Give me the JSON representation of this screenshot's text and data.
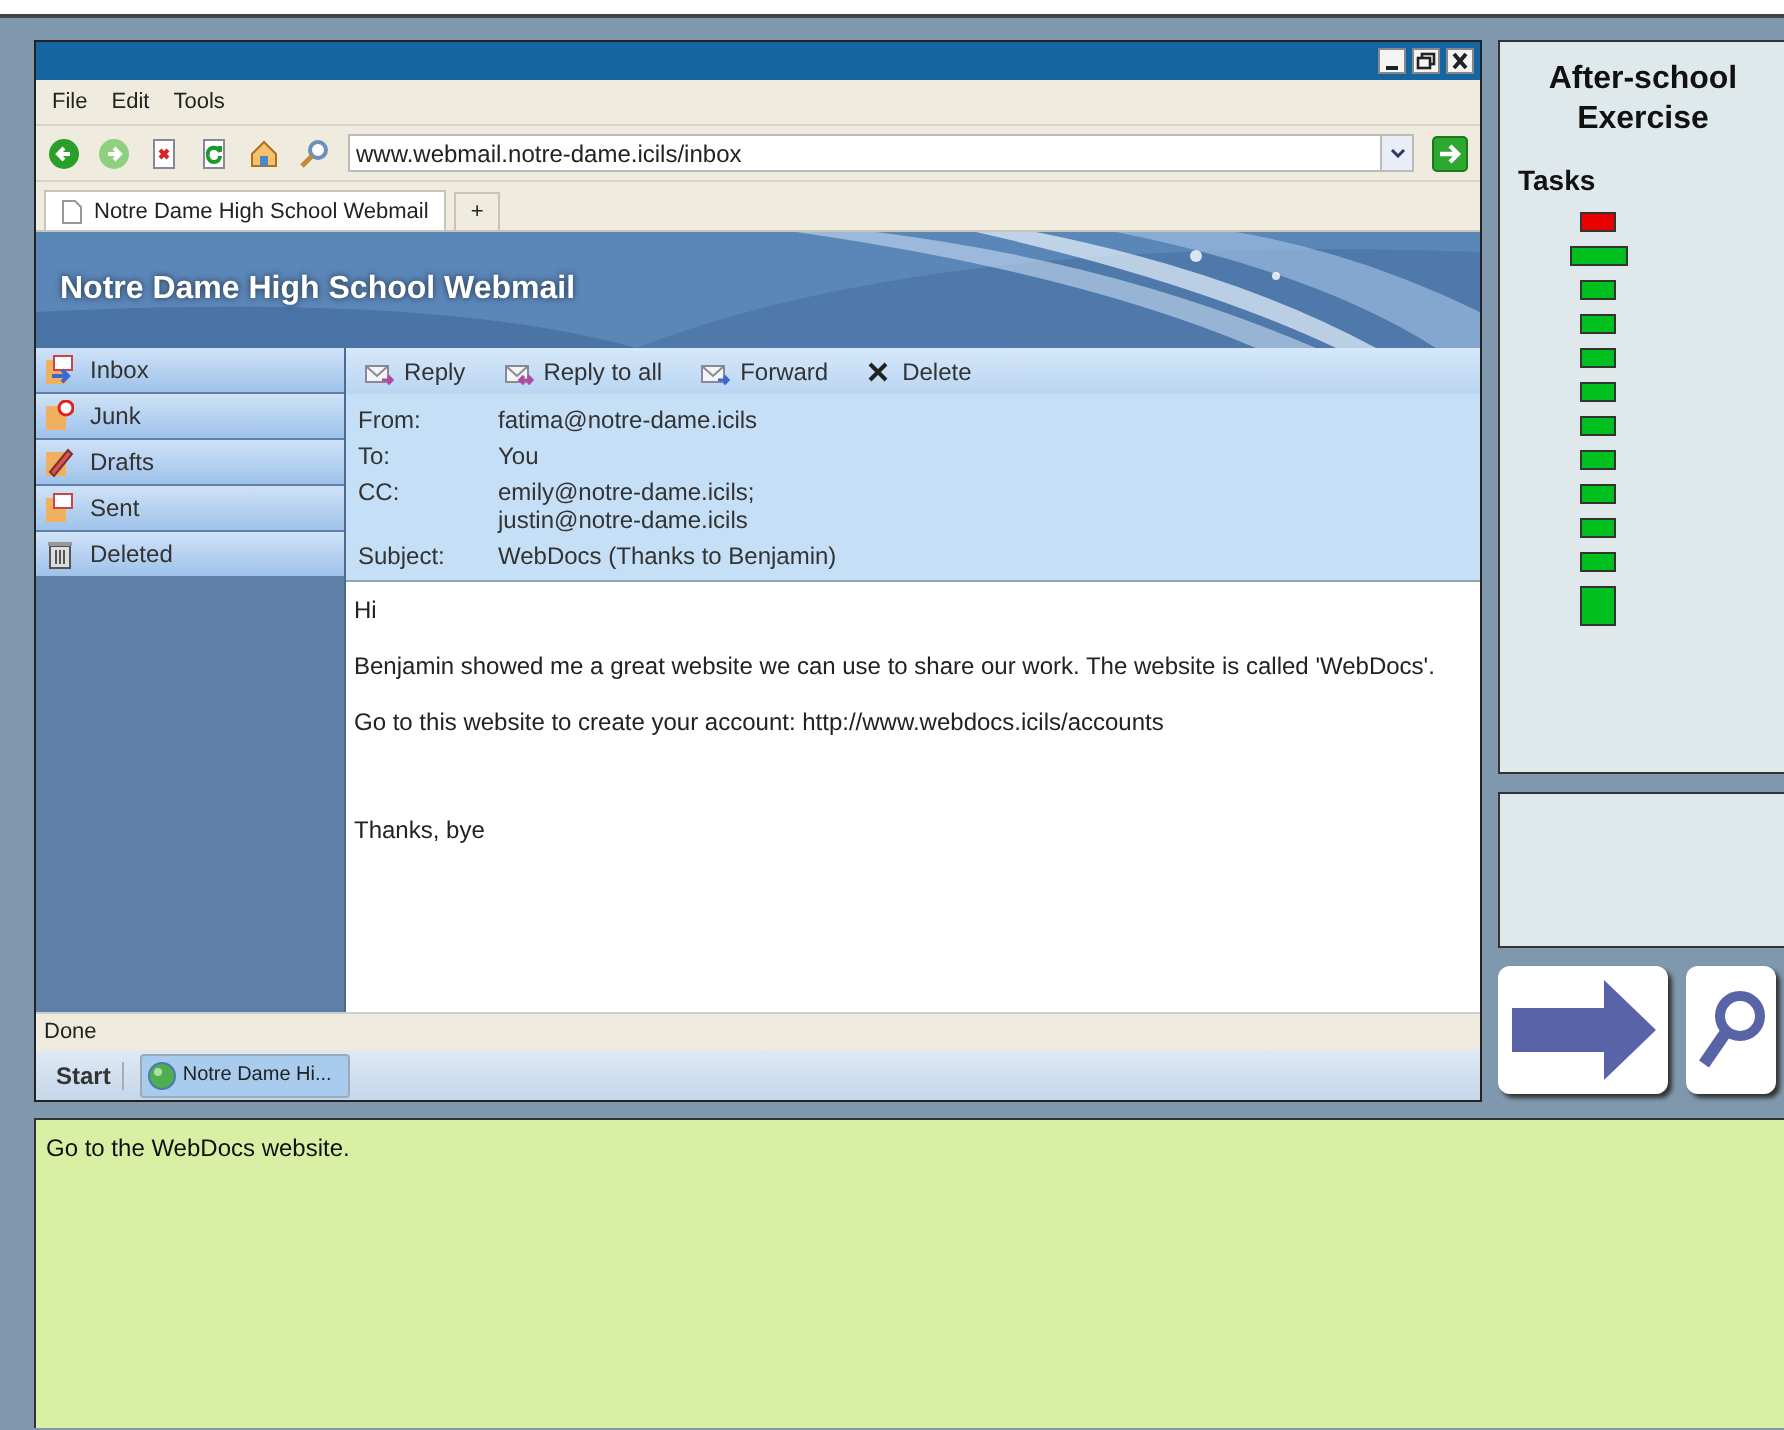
{
  "browser": {
    "menu": [
      "File",
      "Edit",
      "Tools"
    ],
    "address": "www.webmail.notre-dame.icils/inbox",
    "tabs": [
      {
        "label": "Notre Dame High School Webmail",
        "selected": true
      }
    ],
    "new_tab": "+",
    "status": "Done"
  },
  "webmail": {
    "title": "Notre Dame High School Webmail",
    "folders": [
      {
        "label": "Inbox"
      },
      {
        "label": "Junk"
      },
      {
        "label": "Drafts"
      },
      {
        "label": "Sent"
      },
      {
        "label": "Deleted"
      }
    ],
    "actions": [
      {
        "label": "Reply"
      },
      {
        "label": "Reply to all"
      },
      {
        "label": "Forward"
      },
      {
        "label": "Delete"
      }
    ],
    "headers": [
      {
        "label": "From:",
        "value": [
          "fatima@notre-dame.icils"
        ]
      },
      {
        "label": "To:",
        "value": [
          "You"
        ]
      },
      {
        "label": "CC:",
        "value": [
          "emily@notre-dame.icils;",
          "justin@notre-dame.icils"
        ]
      },
      {
        "label": "Subject:",
        "value": [
          "WebDocs (Thanks to Benjamin)"
        ]
      }
    ],
    "body": {
      "paragraphs": [
        "Hi",
        "Benjamin showed me a great website we can use to share our work. The website is called 'WebDocs'.",
        "Go to this website to create your account: http://www.webdocs.icils/accounts"
      ],
      "closing": "Thanks, bye"
    }
  },
  "taskbar": {
    "start": "Start",
    "items": [
      {
        "label": "Notre Dame Hi...",
        "selected": true
      }
    ]
  },
  "panel": {
    "title": "After-school Exercise",
    "tasks_label": "Tasks",
    "tasks": [
      {
        "kind": "regular",
        "color": "#e60000"
      },
      {
        "kind": "current",
        "color": "#00c020"
      },
      {
        "kind": "regular",
        "color": "#00c020"
      },
      {
        "kind": "regular",
        "color": "#00c020"
      },
      {
        "kind": "regular",
        "color": "#00c020"
      },
      {
        "kind": "regular",
        "color": "#00c020"
      },
      {
        "kind": "regular",
        "color": "#00c020"
      },
      {
        "kind": "regular",
        "color": "#00c020"
      },
      {
        "kind": "regular",
        "color": "#00c020"
      },
      {
        "kind": "regular",
        "color": "#00c020"
      },
      {
        "kind": "regular",
        "color": "#00c020"
      },
      {
        "kind": "final",
        "color": "#00c020"
      }
    ]
  },
  "instruction": "Go to the WebDocs website."
}
